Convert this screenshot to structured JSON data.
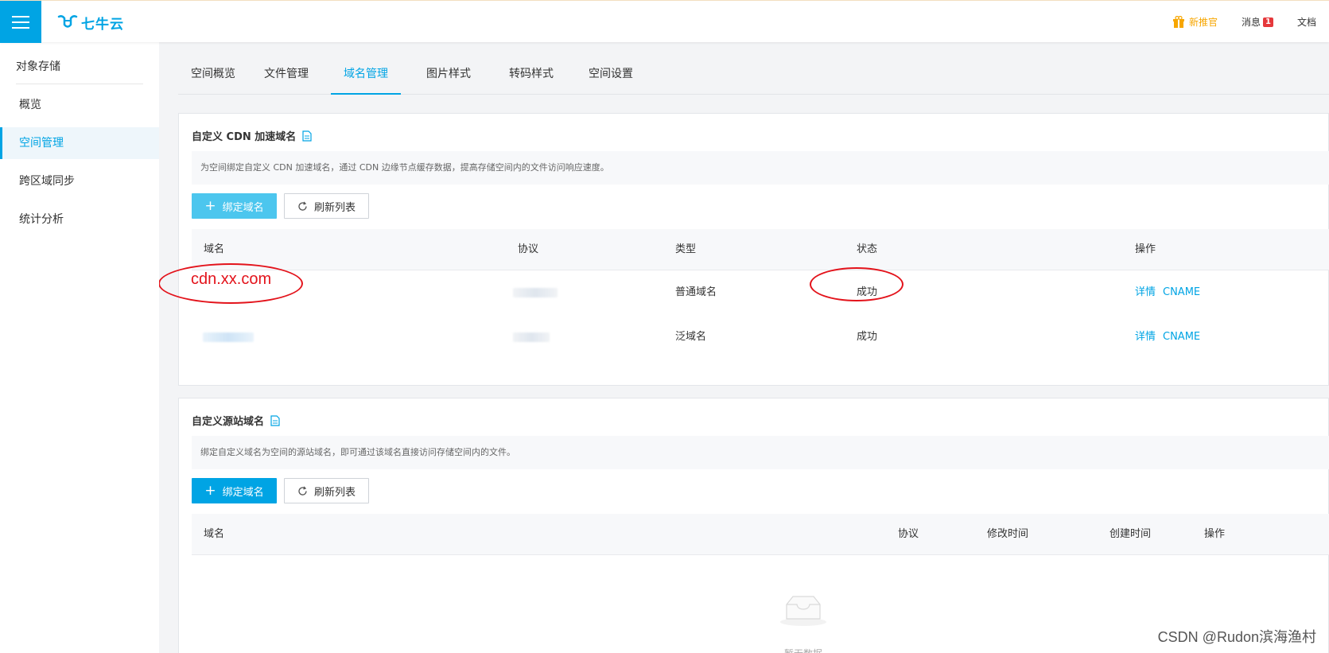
{
  "brand": {
    "logo_text": "七牛云",
    "color": "#00a4e4"
  },
  "topbar": {
    "promo_label": "新推官",
    "messages_label": "消息",
    "messages_count": "1",
    "docs_label": "文档"
  },
  "sidebar": {
    "title": "对象存储",
    "items": [
      {
        "label": "概览"
      },
      {
        "label": "空间管理"
      },
      {
        "label": "跨区域同步"
      },
      {
        "label": "统计分析"
      }
    ]
  },
  "tabs": [
    {
      "label": "空间概览"
    },
    {
      "label": "文件管理"
    },
    {
      "label": "域名管理"
    },
    {
      "label": "图片样式"
    },
    {
      "label": "转码样式"
    },
    {
      "label": "空间设置"
    }
  ],
  "cdn_section": {
    "title": "自定义 CDN 加速域名",
    "description": "为空间绑定自定义 CDN 加速域名，通过 CDN 边缘节点缓存数据，提高存储空间内的文件访问响应速度。",
    "bind_button": "绑定域名",
    "refresh_button": "刷新列表",
    "columns": [
      "域名",
      "协议",
      "类型",
      "状态",
      "操作"
    ],
    "rows": [
      {
        "type": "普通域名",
        "status": "成功",
        "action_detail": "详情",
        "action_cname": "CNAME"
      },
      {
        "type": "泛域名",
        "status": "成功",
        "action_detail": "详情",
        "action_cname": "CNAME"
      }
    ]
  },
  "annotation": {
    "domain_text": "cdn.xx.com",
    "color": "#e3131b"
  },
  "source_section": {
    "title": "自定义源站域名",
    "description": "绑定自定义域名为空间的源站域名，即可通过该域名直接访问存储空间内的文件。",
    "bind_button": "绑定域名",
    "refresh_button": "刷新列表",
    "columns": [
      "域名",
      "协议",
      "修改时间",
      "创建时间",
      "操作"
    ],
    "empty_text": "暂无数据"
  },
  "watermark": "CSDN @Rudon滨海渔村"
}
